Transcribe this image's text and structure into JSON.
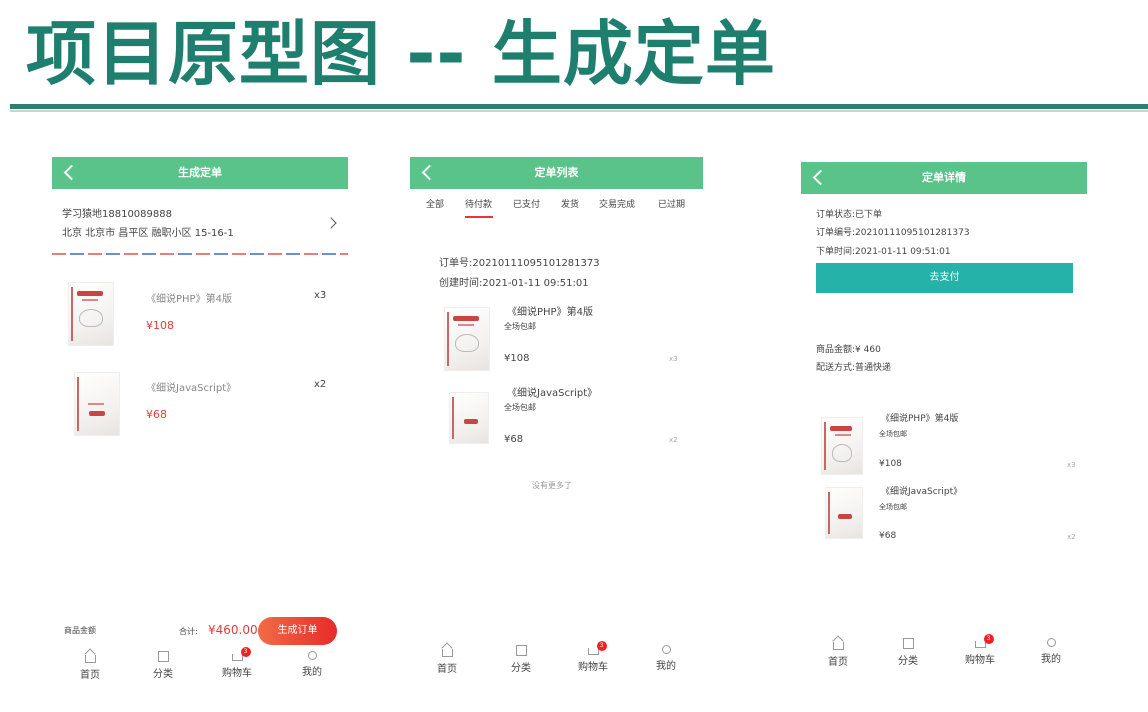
{
  "slide": {
    "title": "项目原型图 -- 生成定单"
  },
  "screen1": {
    "title": "生成定单",
    "address": {
      "name_phone": "学习猿地18810089888",
      "detail": "北京 北京市 昌平区 融职小区 15-16-1"
    },
    "items": [
      {
        "name": "《细说PHP》第4版",
        "price": "¥108",
        "qty": "x3"
      },
      {
        "name": "《细说JavaScript》",
        "price": "¥68",
        "qty": "x2"
      }
    ],
    "footer": {
      "amount_label": "商品金额",
      "total_label": "合计:",
      "total_value": "¥460.00",
      "submit": "生成订单"
    }
  },
  "screen2": {
    "title": "定单列表",
    "tabs": [
      "全部",
      "待付款",
      "已支付",
      "发货",
      "交易完成",
      "已过期"
    ],
    "active_tab": "待付款",
    "order_no": "订单号:20210111095101281373",
    "created": "创建时间:2021-01-11 09:51:01",
    "items": [
      {
        "name": "《细说PHP》第4版",
        "tag": "全场包邮",
        "price": "¥108",
        "qty": "x3"
      },
      {
        "name": "《细说JavaScript》",
        "tag": "全场包邮",
        "price": "¥68",
        "qty": "x2"
      }
    ],
    "no_more": "没有更多了"
  },
  "screen3": {
    "title": "定单详情",
    "status": "订单状态:已下单",
    "order_no": "订单编号:20210111095101281373",
    "time": "下单时间:2021-01-11 09:51:01",
    "pay_button": "去支付",
    "amount": "商品金额:¥ 460",
    "shipping": "配送方式:普通快递",
    "items": [
      {
        "name": "《细说PHP》第4版",
        "tag": "全场包邮",
        "price": "¥108",
        "qty": "x3"
      },
      {
        "name": "《细说JavaScript》",
        "tag": "全场包邮",
        "price": "¥68",
        "qty": "x2"
      }
    ]
  },
  "tabbar": {
    "items": [
      "首页",
      "分类",
      "购物车",
      "我的"
    ],
    "cart_badge": "3"
  },
  "colors": {
    "header_green": "#5ac389",
    "title_teal": "#1f7f6f",
    "price_red": "#e23b3b",
    "pay_teal": "#25b2a8"
  }
}
